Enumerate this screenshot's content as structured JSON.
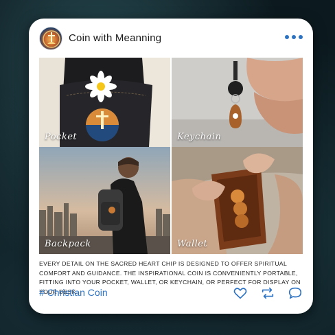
{
  "post": {
    "title": "Coin with Meanning",
    "menu_icon": "more-dots-icon",
    "avatar_icon": "coin-avatar"
  },
  "gallery": [
    {
      "label": "Pocket"
    },
    {
      "label": "Keychain"
    },
    {
      "label": "Backpack"
    },
    {
      "label": "Wallet"
    }
  ],
  "description": "Every detail on the sacred heart chip is designed to offer spiritual comfort and guidance. The inspirational coin is conveniently portable, fitting into your pocket, wallet, or keychain, or perfect for display on your desk.",
  "hashtag": "# Christian Coin",
  "actions": [
    "heart-icon",
    "repost-icon",
    "comment-icon"
  ],
  "colors": {
    "accent": "#2d73c4",
    "card": "#ffffff",
    "background": "#0c1a1f"
  }
}
